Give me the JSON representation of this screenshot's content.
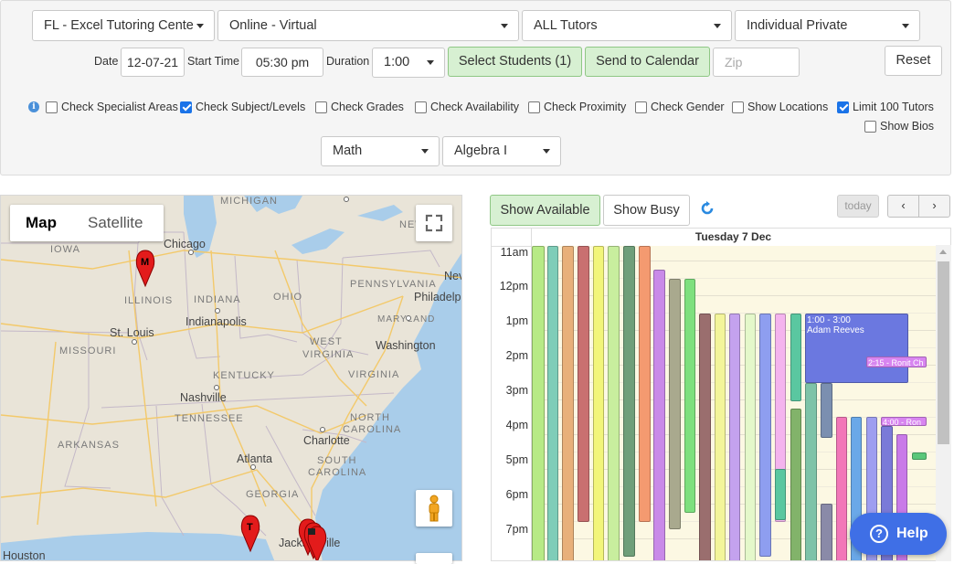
{
  "filters": {
    "center": "FL - Excel Tutoring Cente",
    "mode": "Online - Virtual",
    "tutors": "ALL Tutors",
    "session_type": "Individual Private",
    "subject": "Math",
    "level": "Algebra I"
  },
  "schedule": {
    "date_label": "Date",
    "date_value": "12-07-21",
    "start_label": "Start Time",
    "start_value": "05:30 pm",
    "duration_label": "Duration",
    "duration_value": "1:00",
    "zip_placeholder": "Zip"
  },
  "buttons": {
    "select_students": "Select Students (1)",
    "send_calendar": "Send to Calendar",
    "reset": "Reset",
    "show_available": "Show Available",
    "show_busy": "Show Busy",
    "today": "today",
    "prev": "‹",
    "next": "›",
    "help": "Help",
    "help_icon": "?"
  },
  "checks": [
    {
      "label": "Check Specialist Areas",
      "checked": false
    },
    {
      "label": "Check Subject/Levels",
      "checked": true
    },
    {
      "label": "Check Grades",
      "checked": false
    },
    {
      "label": "Check Availability",
      "checked": false
    },
    {
      "label": "Check Proximity",
      "checked": false
    },
    {
      "label": "Check Gender",
      "checked": false
    },
    {
      "label": "Show Locations",
      "checked": false
    },
    {
      "label": "Limit 100 Tutors",
      "checked": true
    },
    {
      "label": "Show Bios",
      "checked": false
    }
  ],
  "map": {
    "tab_map": "Map",
    "tab_satellite": "Satellite",
    "labels": {
      "michigan": "MICHIGAN",
      "new": "NEW",
      "iowa": "IOWA",
      "chicago": "Chicago",
      "pennsylvania": "PENNSYLVANIA",
      "ne": "Nev",
      "illinois": "ILLINOIS",
      "indiana": "INDIANA",
      "ohio": "OHIO",
      "philadelphia": "Philadelph",
      "stlouis": "St. Louis",
      "indianapolis": "Indianapolis",
      "maryland": "MARYLAND",
      "washington": "Washington",
      "missouri": "MISSOURI",
      "westvirginia1": "WEST",
      "westvirginia2": "VIRGINIA",
      "kentucky": "KENTUCKY",
      "virginia": "VIRGINIA",
      "nashville": "Nashville",
      "tennessee": "TENNESSEE",
      "northcarolina1": "NORTH",
      "northcarolina2": "CAROLINA",
      "arkansas": "ARKANSAS",
      "charlotte": "Charlotte",
      "southcarolina1": "SOUTH",
      "southcarolina2": "CAROLINA",
      "atlanta": "Atlanta",
      "georgia": "GEORGIA",
      "houston": "Houston",
      "jacksonville": "Jacksonville",
      "marker_m": "M",
      "marker_t": "T"
    }
  },
  "calendar": {
    "day_title": "Tuesday 7 Dec",
    "hours": [
      "11am",
      "12pm",
      "1pm",
      "2pm",
      "3pm",
      "4pm",
      "5pm",
      "6pm",
      "7pm"
    ],
    "event_title": "1:00 - 3:00",
    "event_name": "Adam Reeves",
    "event_small": "2:15 - Ronit Ch",
    "event_small2": "4:00 - Ron"
  }
}
